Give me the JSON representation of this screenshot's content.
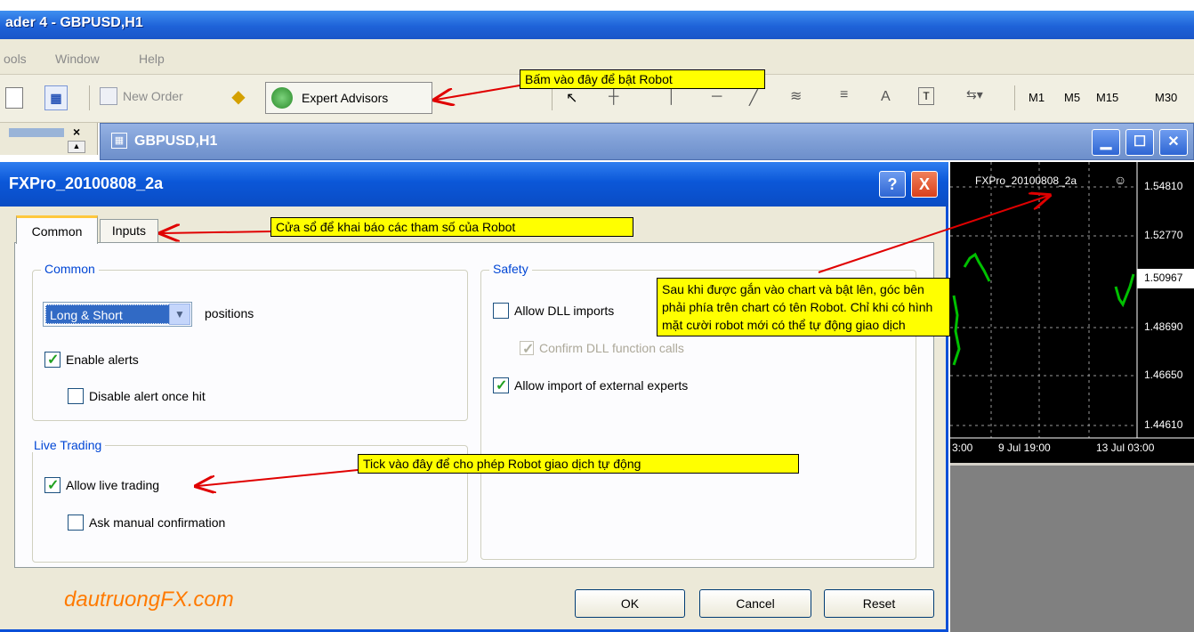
{
  "window": {
    "title": "ader 4 - GBPUSD,H1"
  },
  "menu": {
    "items": [
      "ools",
      "Window",
      "Help"
    ]
  },
  "toolbar": {
    "new_order": "New Order",
    "expert_advisors": "Expert Advisors",
    "text_tool": "A",
    "timeframes": [
      "M1",
      "M5",
      "M15",
      "M30"
    ]
  },
  "chart_window": {
    "title": "GBPUSD,H1"
  },
  "chart": {
    "ea_label": "FXPro_20100808_2a",
    "prices": [
      "1.54810",
      "1.52770",
      "1.50967",
      "1.48690",
      "1.46650",
      "1.44610"
    ],
    "times": [
      "3:00",
      "9 Jul 19:00",
      "13 Jul 03:00"
    ]
  },
  "dialog": {
    "title": "FXPro_20100808_2a",
    "help": "?",
    "close": "X",
    "tabs": [
      "Common",
      "Inputs"
    ],
    "common_group": "Common",
    "positions_value": "Long & Short",
    "positions_label": "positions",
    "enable_alerts": "Enable alerts",
    "disable_alert": "Disable alert once hit",
    "live_group": "Live Trading",
    "allow_live": "Allow live trading",
    "ask_manual": "Ask manual confirmation",
    "safety_group": "Safety",
    "allow_dll": "Allow DLL imports",
    "confirm_dll": "Confirm DLL function calls",
    "allow_import": "Allow import of external experts",
    "ok": "OK",
    "cancel": "Cancel",
    "reset": "Reset"
  },
  "annotations": {
    "expert_advisors": "Bấm vào đây để bật Robot",
    "inputs": "Cửa sổ để khai báo các tham số của Robot",
    "chart": "Sau khi được gắn vào chart và bật lên, góc bên phải phía trên chart có tên Robot. Chỉ khi có hình mặt cười robot mới có thể tự động giao dịch",
    "live_trading": "Tick vào đây để cho phép Robot giao dịch tự động"
  },
  "watermark": "dautruongFX.com",
  "colors": {
    "title_blue": "#0b57d8",
    "note_yellow": "#ffff00",
    "arrow_red": "#e00000",
    "watermark_orange": "#ff7a00",
    "candle_green": "#00c000"
  }
}
